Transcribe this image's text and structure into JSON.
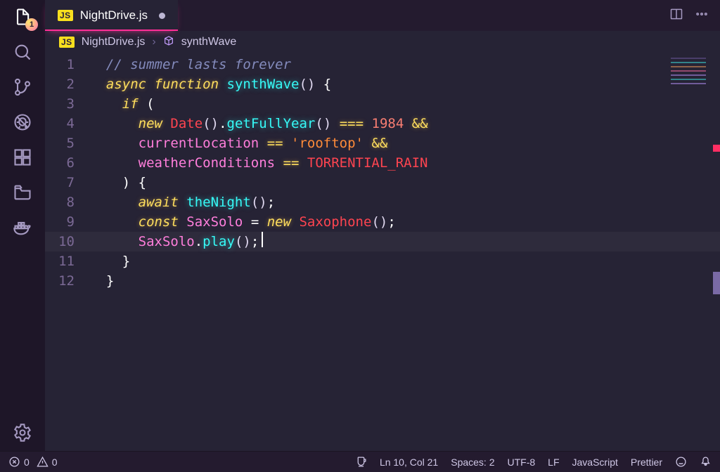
{
  "tab": {
    "label": "NightDrive.js",
    "lang_badge": "JS",
    "dirty": true
  },
  "tab_actions": {
    "split": "split-editor-icon",
    "more": "more-icon"
  },
  "breadcrumb": {
    "file_badge": "JS",
    "file": "NightDrive.js",
    "symbol": "synthWave"
  },
  "activity": {
    "explorer_badge": "1"
  },
  "gutter": [
    "1",
    "2",
    "3",
    "4",
    "5",
    "6",
    "7",
    "8",
    "9",
    "10",
    "11",
    "12"
  ],
  "code": {
    "l1_comment": "// summer lasts forever",
    "l2_async": "async",
    "l2_function": "function",
    "l2_name": "synthWave",
    "l3_if": "if",
    "l4_new": "new",
    "l4_date": "Date",
    "l4_getfy": "getFullYear",
    "l4_eq": "===",
    "l4_year": "1984",
    "l4_and": "&&",
    "l5_var": "currentLocation",
    "l5_eq": "==",
    "l5_str": "'rooftop'",
    "l5_and": "&&",
    "l6_var": "weatherConditions",
    "l6_eq": "==",
    "l6_const": "TORRENTIAL_RAIN",
    "l8_await": "await",
    "l8_fn": "theNight",
    "l9_const": "const",
    "l9_name": "SaxSolo",
    "l9_new": "new",
    "l9_type": "Saxophone",
    "l10_obj": "SaxSolo",
    "l10_fn": "play"
  },
  "status": {
    "errors": "0",
    "warnings": "0",
    "ln_col": "Ln 10, Col 21",
    "spaces": "Spaces: 2",
    "encoding": "UTF-8",
    "eol": "LF",
    "language": "JavaScript",
    "formatter": "Prettier"
  }
}
